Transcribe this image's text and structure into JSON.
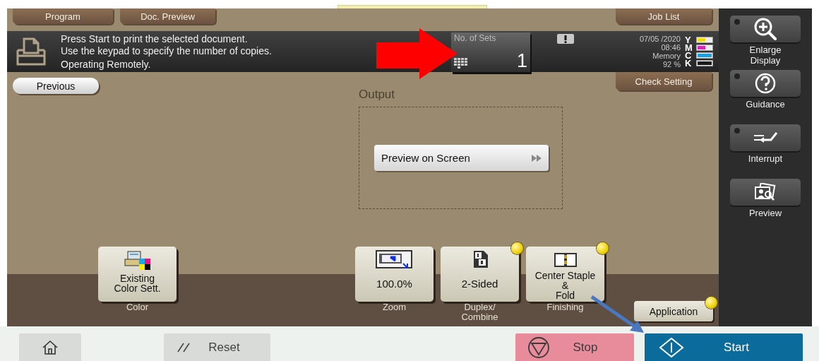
{
  "top_tabs": [
    {
      "label": "Program"
    },
    {
      "label": "Doc. Preview"
    }
  ],
  "job_list_tab": {
    "label": "Job List"
  },
  "status": {
    "messages": [
      "Press Start to print the selected document.",
      "Use the keypad to specify the number of copies.",
      "Operating Remotely."
    ],
    "sets": {
      "label": "No. of Sets",
      "value": "1"
    },
    "date": "07/05 /2020",
    "time": "08:46",
    "memory_label": "Memory",
    "memory_value": "92 %",
    "toners": [
      {
        "letter": "Y",
        "color": "#f0e000",
        "level": 0.55
      },
      {
        "letter": "M",
        "color": "#e020c0",
        "level": 0.55
      },
      {
        "letter": "C",
        "color": "#1aa0e0",
        "level": 1
      },
      {
        "letter": "K",
        "color": "#1a1a1a",
        "level": 1
      }
    ]
  },
  "previous_button": {
    "label": "Previous"
  },
  "check_setting_tab": {
    "label": "Check Setting"
  },
  "output": {
    "title": "Output",
    "preview_button": {
      "label": "Preview on Screen"
    }
  },
  "function_keys": [
    {
      "kind": "color",
      "value": "Existing\nColor Sett.",
      "caption": "Color",
      "set": false
    },
    {
      "kind": "zoom",
      "value": "100.0%",
      "caption": "Zoom",
      "set": false
    },
    {
      "kind": "duplex",
      "value": "2-Sided",
      "caption": "Duplex/\nCombine",
      "set": true
    },
    {
      "kind": "finishing",
      "value": "Center Staple\n&\nFold",
      "caption": "Finishing",
      "set": true
    }
  ],
  "application_button": {
    "label": "Application",
    "set": true
  },
  "side_keys": [
    {
      "kind": "enlarge",
      "label": "Enlarge\nDisplay",
      "led": true
    },
    {
      "kind": "guidance",
      "label": "Guidance",
      "led": true
    },
    {
      "kind": "interrupt",
      "label": "Interrupt",
      "led": true
    },
    {
      "kind": "preview",
      "label": "Preview",
      "led": false
    }
  ],
  "bottom_buttons": [
    {
      "kind": "home"
    },
    {
      "kind": "reset",
      "label": "Reset"
    },
    {
      "kind": "stop",
      "label": "Stop"
    },
    {
      "kind": "start",
      "label": "Start"
    }
  ],
  "annotations": [
    {
      "kind": "block-arrow",
      "color": "#ff0000"
    },
    {
      "kind": "line-arrow",
      "color": "#4a78c0"
    }
  ]
}
